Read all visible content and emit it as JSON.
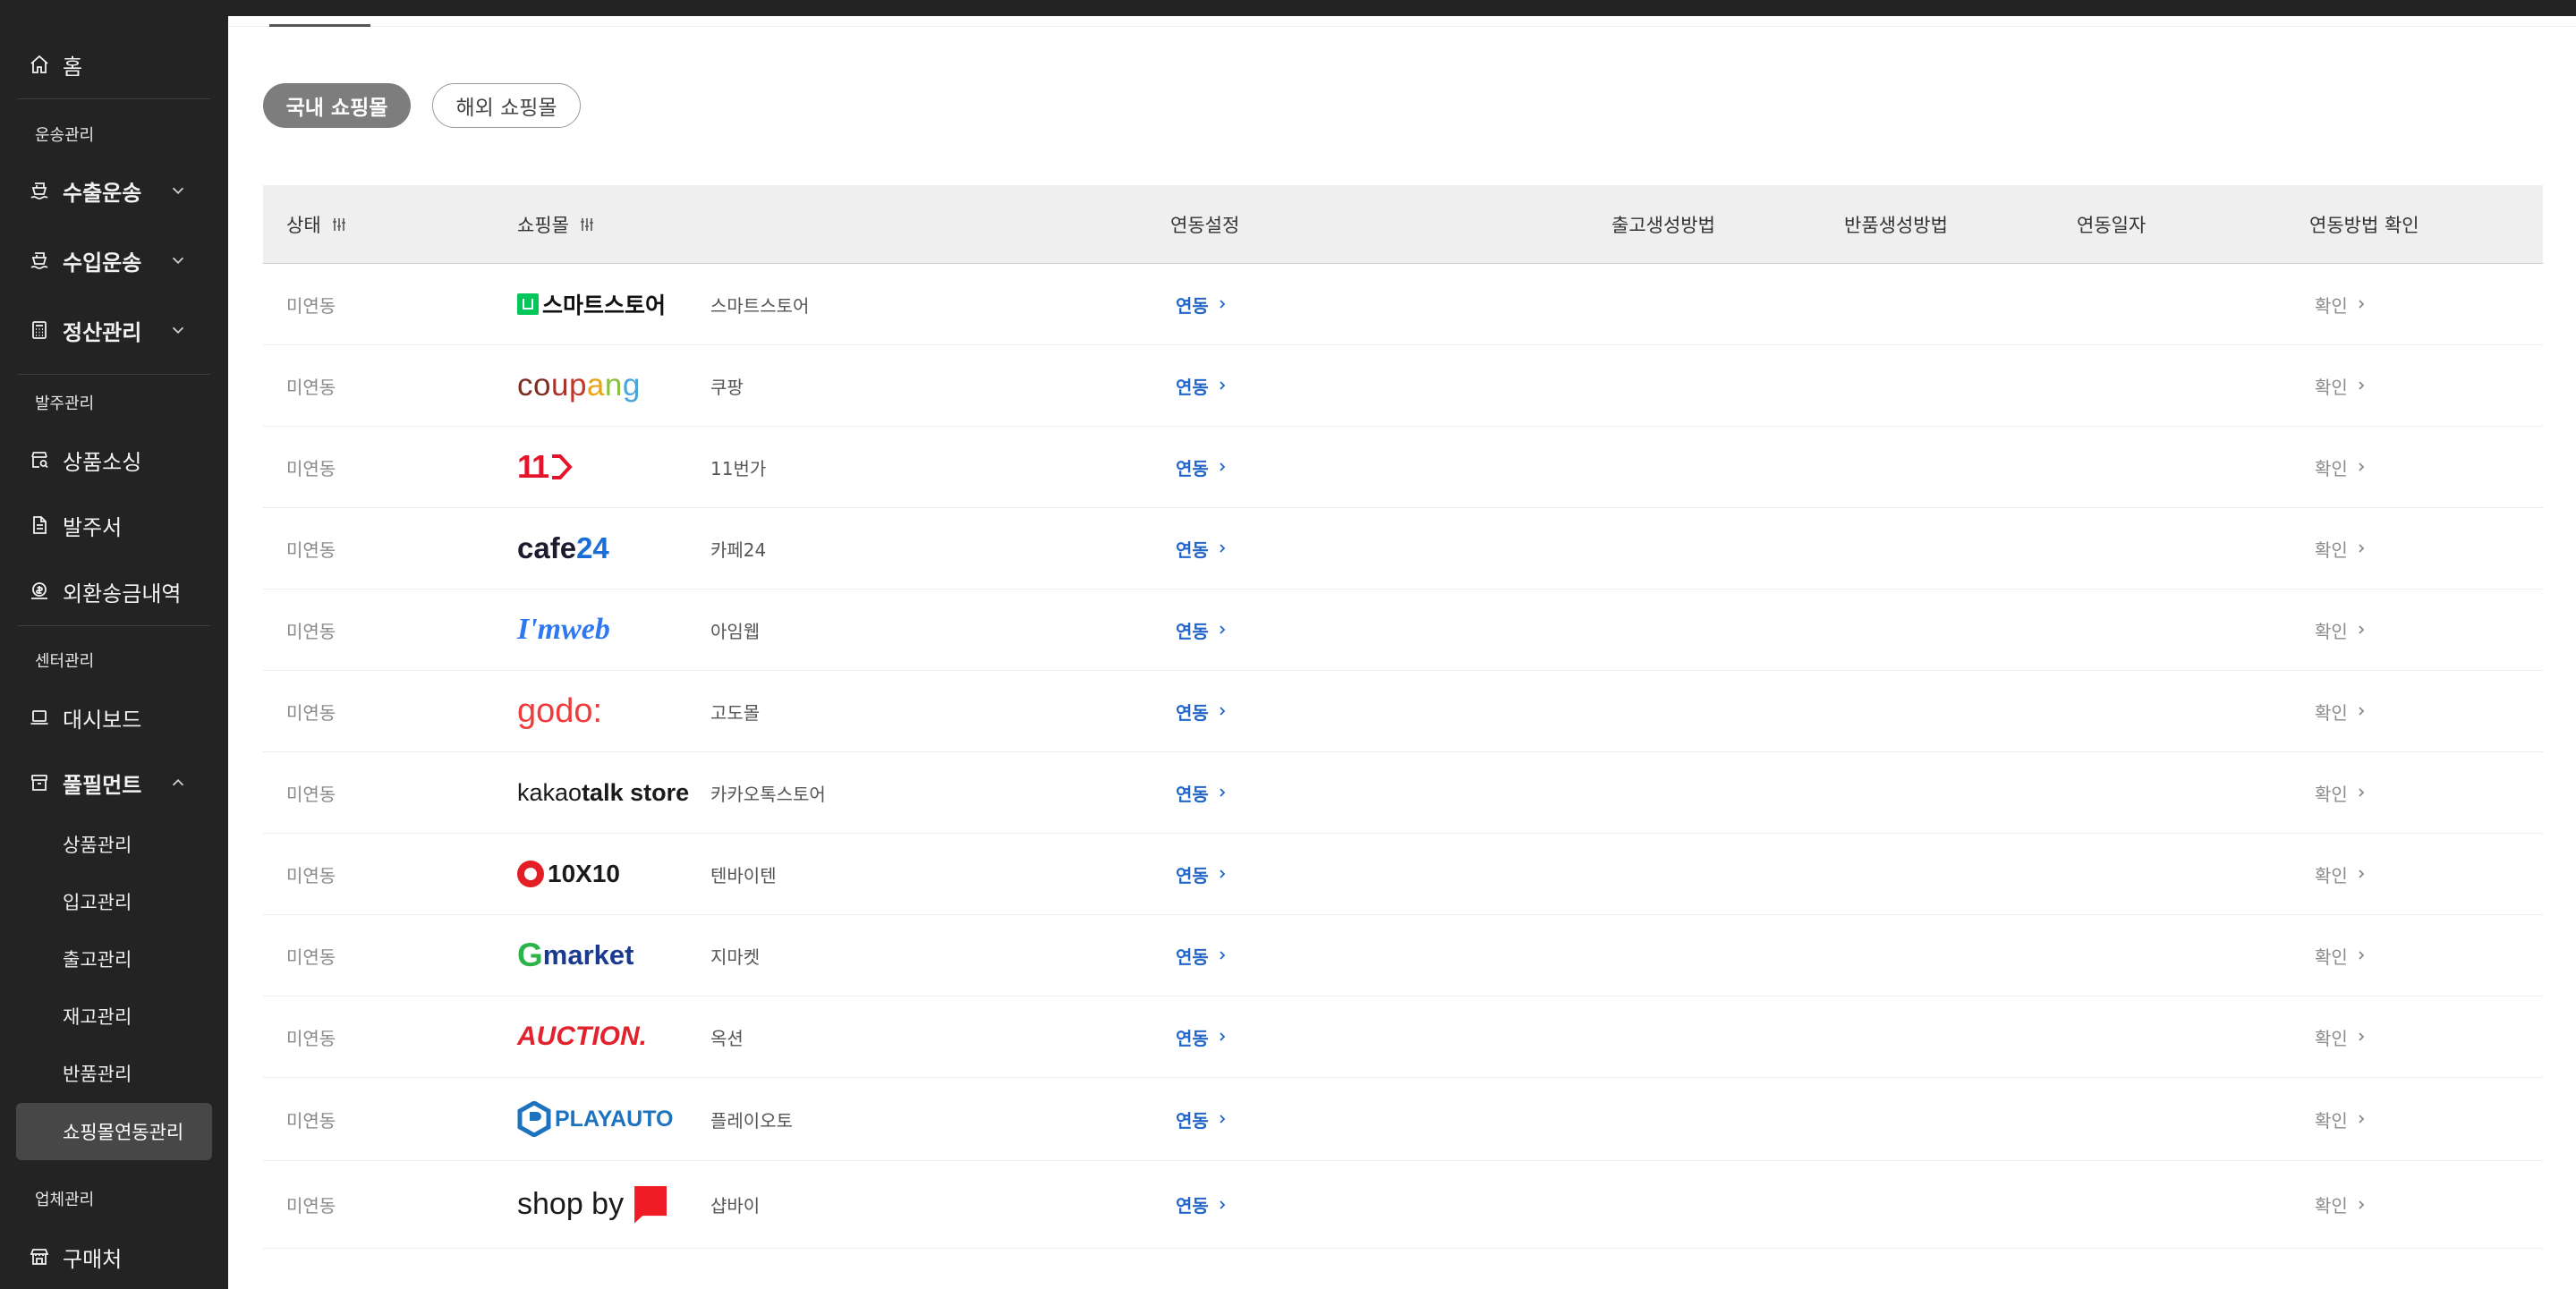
{
  "sidebar": {
    "home": "홈",
    "sections": {
      "shipping": "운송관리",
      "ordering": "발주관리",
      "center": "센터관리",
      "vendor": "업체관리"
    },
    "items": {
      "export": "수출운송",
      "import": "수입운송",
      "settlement": "정산관리",
      "sourcing": "상품소싱",
      "purchase_order": "발주서",
      "remittance": "외환송금내역",
      "dashboard": "대시보드",
      "fulfillment": "풀필먼트",
      "buyer": "구매처"
    },
    "fulfillment_sub": [
      "상품관리",
      "입고관리",
      "출고관리",
      "재고관리",
      "반품관리",
      "쇼핑몰연동관리"
    ]
  },
  "pills": {
    "domestic": "국내 쇼핑몰",
    "overseas": "해외 쇼핑몰"
  },
  "table": {
    "headers": {
      "status": "상태",
      "mall": "쇼핑몰",
      "setting": "연동설정",
      "outbound": "출고생성방법",
      "return": "반품생성방법",
      "date": "연동일자",
      "method": "연동방법 확인"
    },
    "rows": [
      {
        "status": "미연동",
        "logo": "스마트스토어",
        "mall": "스마트스토어",
        "link": "연동",
        "confirm": "확인"
      },
      {
        "status": "미연동",
        "logo": "coupang",
        "mall": "쿠팡",
        "link": "연동",
        "confirm": "확인"
      },
      {
        "status": "미연동",
        "logo": "11",
        "mall": "11번가",
        "link": "연동",
        "confirm": "확인"
      },
      {
        "status": "미연동",
        "logo": "cafe24",
        "mall": "카페24",
        "link": "연동",
        "confirm": "확인"
      },
      {
        "status": "미연동",
        "logo": "I'mweb",
        "mall": "아임웹",
        "link": "연동",
        "confirm": "확인"
      },
      {
        "status": "미연동",
        "logo": "godo:",
        "mall": "고도몰",
        "link": "연동",
        "confirm": "확인"
      },
      {
        "status": "미연동",
        "logo": "kakaotalk store",
        "mall": "카카오톡스토어",
        "link": "연동",
        "confirm": "확인"
      },
      {
        "status": "미연동",
        "logo": "10X10",
        "mall": "텐바이텐",
        "link": "연동",
        "confirm": "확인"
      },
      {
        "status": "미연동",
        "logo": "Gmarket",
        "mall": "지마켓",
        "link": "연동",
        "confirm": "확인"
      },
      {
        "status": "미연동",
        "logo": "AUCTION.",
        "mall": "옥션",
        "link": "연동",
        "confirm": "확인"
      },
      {
        "status": "미연동",
        "logo": "PLAYAUTO",
        "mall": "플레이오토",
        "link": "연동",
        "confirm": "확인"
      },
      {
        "status": "미연동",
        "logo": "shop by",
        "mall": "샵바이",
        "link": "연동",
        "confirm": "확인"
      }
    ]
  },
  "colors": {
    "sidebar_bg": "#232323",
    "link_blue": "#2366c9",
    "pill_active": "#7d7d7d",
    "header_bg": "#efefef"
  }
}
